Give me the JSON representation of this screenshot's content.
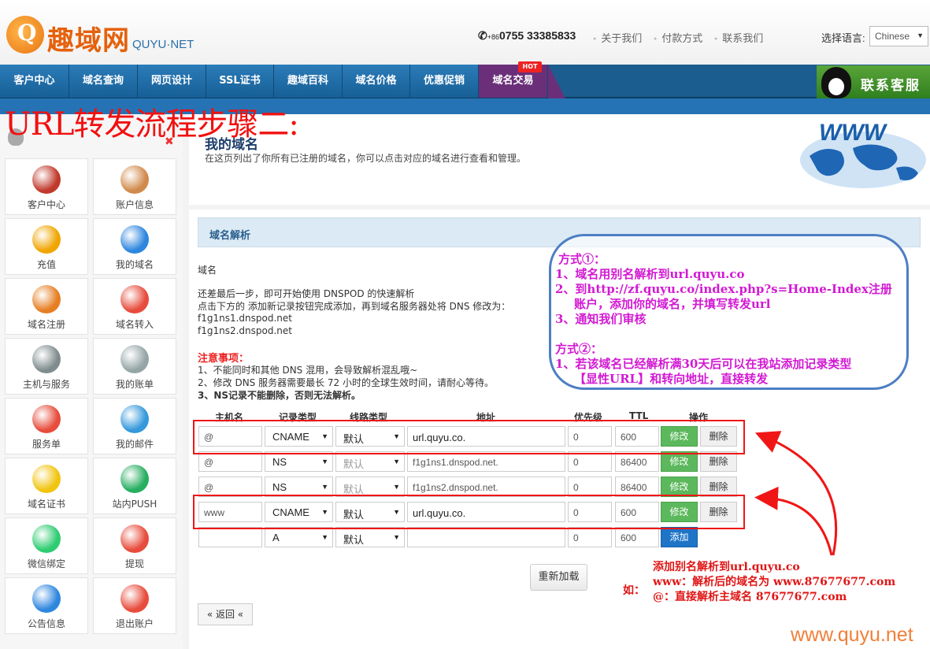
{
  "header": {
    "logo_cn": "趣域网",
    "logo_en": "QUYU·NET",
    "phone_prefix": "+86",
    "phone": "0755 33385833",
    "links": [
      "关于我们",
      "付款方式",
      "联系我们"
    ],
    "lang_label": "选择语言:",
    "lang_value": "Chinese"
  },
  "nav": {
    "items": [
      "客户中心",
      "域名查询",
      "网页设计",
      "SSL证书",
      "趣域百科",
      "域名价格",
      "优惠促销",
      "域名交易"
    ],
    "hot_badge": "HOT",
    "service": "联系客服"
  },
  "annotation_title": "URL转发流程步骤二:",
  "sidebar": {
    "tiles": [
      {
        "label": "客户中心",
        "icon": "house-icon",
        "color": "#c0392b"
      },
      {
        "label": "账户信息",
        "icon": "user-icon",
        "color": "#d18a4c"
      },
      {
        "label": "充值",
        "icon": "coins-icon",
        "color": "#f0a500"
      },
      {
        "label": "我的域名",
        "icon": "globe-icon",
        "color": "#2e86de"
      },
      {
        "label": "域名注册",
        "icon": "cart-icon",
        "color": "#e67e22"
      },
      {
        "label": "域名转入",
        "icon": "transfer-icon",
        "color": "#e74c3c"
      },
      {
        "label": "主机与服务",
        "icon": "server-icon",
        "color": "#7f8c8d"
      },
      {
        "label": "我的账单",
        "icon": "bill-icon",
        "color": "#95a5a6"
      },
      {
        "label": "服务单",
        "icon": "lifebuoy-icon",
        "color": "#e74c3c"
      },
      {
        "label": "我的邮件",
        "icon": "mail-icon",
        "color": "#3498db"
      },
      {
        "label": "域名证书",
        "icon": "certificate-icon",
        "color": "#f1c40f"
      },
      {
        "label": "站内PUSH",
        "icon": "push-icon",
        "color": "#27ae60"
      },
      {
        "label": "微信绑定",
        "icon": "wechat-icon",
        "color": "#2ecc71"
      },
      {
        "label": "提现",
        "icon": "cash-icon",
        "color": "#e74c3c"
      },
      {
        "label": "公告信息",
        "icon": "question-icon",
        "color": "#2e86de"
      },
      {
        "label": "退出账户",
        "icon": "power-icon",
        "color": "#e74c3c"
      }
    ]
  },
  "main": {
    "title": "我的域名",
    "desc": "在这页列出了你所有已注册的域名，你可以点击对应的域名进行查看和管理。",
    "section": "域名解析",
    "domain_label": "域名",
    "intro1": "还差最后一步，即可开始使用 DNSPOD 的快速解析",
    "intro2": "点击下方的 添加新记录按钮完成添加，再到域名服务器处将 DNS 修改为：",
    "ns1": "f1g1ns1.dnspod.net",
    "ns2": "f1g1ns2.dnspod.net",
    "notes_title": "注意事项：",
    "note1": "1、不能同时和其他 DNS 混用，会导致解析混乱哦~",
    "note2": "2、修改 DNS 服务器需要最长 72 小时的全球生效时间，请耐心等待。",
    "note3": "3、NS记录不能删除，否则无法解析。"
  },
  "table": {
    "headers": [
      "主机名",
      "记录类型",
      "线路类型",
      "地址",
      "优先级",
      "TTL",
      "操作"
    ],
    "rows": [
      {
        "host": "@",
        "type": "CNAME",
        "line": "默认",
        "addr": "url.quyu.co.",
        "prio": "0",
        "ttl": "600",
        "edit": "修改",
        "del": "删除"
      },
      {
        "host": "@",
        "type": "NS",
        "line": "默认",
        "addr": "f1g1ns1.dnspod.net.",
        "prio": "0",
        "ttl": "86400",
        "edit": "修改",
        "del": "删除"
      },
      {
        "host": "@",
        "type": "NS",
        "line": "默认",
        "addr": "f1g1ns2.dnspod.net.",
        "prio": "0",
        "ttl": "86400",
        "edit": "修改",
        "del": "删除"
      },
      {
        "host": "www",
        "type": "CNAME",
        "line": "默认",
        "addr": "url.quyu.co.",
        "prio": "0",
        "ttl": "600",
        "edit": "修改",
        "del": "删除"
      }
    ],
    "new_row": {
      "host": "",
      "type": "A",
      "line": "默认",
      "addr": "",
      "prio": "0",
      "ttl": "600",
      "add": "添加"
    },
    "reload": "重新加载",
    "back": "« 返回 «"
  },
  "callout": {
    "l1": "方式①：",
    "l2": "1、域名用别名解析到url.quyu.co",
    "l3": "2、到http://zf.quyu.co/index.php?s=Home-Index注册",
    "l4": "账户，添加你的域名，并填写转发url",
    "l5": "3、通知我们审核",
    "l6": "方式②：",
    "l7": "1、若该域名已经解析满30天后可以在我站添加记录类型",
    "l8": "【显性URL】和转向地址，直接转发"
  },
  "example": {
    "prefix": "如：",
    "l1": "添加别名解析到url.quyu.co",
    "l2": "www：解析后的域名为 www.87677677.com",
    "l3": "@：直接解析主域名 87677677.com"
  },
  "watermark": "www.quyu.net"
}
